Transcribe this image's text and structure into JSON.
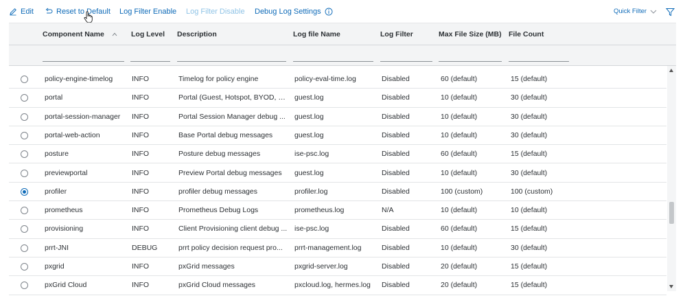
{
  "toolbar": {
    "edit_label": "Edit",
    "reset_label": "Reset to Default",
    "enable_label": "Log Filter Enable",
    "disable_label": "Log Filter Disable",
    "debug_label": "Debug Log Settings",
    "quick_filter_label": "Quick Filter"
  },
  "colors": {
    "link": "#0d6ab8",
    "link_disabled": "#8fc3e6",
    "header_bg": "#f3f4f5"
  },
  "columns": [
    "Component Name",
    "Log Level",
    "Description",
    "Log file Name",
    "Log Filter",
    "Max File Size (MB)",
    "File Count"
  ],
  "rows": [
    {
      "selected": false,
      "name": "policy-engine-timelog",
      "level": "INFO",
      "description": "Timelog for policy engine",
      "file": "policy-eval-time.log",
      "filter": "Disabled",
      "max_size": "60 (default)",
      "count": "15 (default)"
    },
    {
      "selected": false,
      "name": "portal",
      "level": "INFO",
      "description": "Portal (Guest, Hotspot, BYOD, C...",
      "file": "guest.log",
      "filter": "Disabled",
      "max_size": "10 (default)",
      "count": "30 (default)"
    },
    {
      "selected": false,
      "name": "portal-session-manager",
      "level": "INFO",
      "description": "Portal Session Manager debug ...",
      "file": "guest.log",
      "filter": "Disabled",
      "max_size": "10 (default)",
      "count": "30 (default)"
    },
    {
      "selected": false,
      "name": "portal-web-action",
      "level": "INFO",
      "description": "Base Portal debug messages",
      "file": "guest.log",
      "filter": "Disabled",
      "max_size": "10 (default)",
      "count": "30 (default)"
    },
    {
      "selected": false,
      "name": "posture",
      "level": "INFO",
      "description": "Posture debug messages",
      "file": "ise-psc.log",
      "filter": "Disabled",
      "max_size": "60 (default)",
      "count": "15 (default)"
    },
    {
      "selected": false,
      "name": "previewportal",
      "level": "INFO",
      "description": "Preview Portal debug messages",
      "file": "guest.log",
      "filter": "Disabled",
      "max_size": "10 (default)",
      "count": "30 (default)"
    },
    {
      "selected": true,
      "name": "profiler",
      "level": "INFO",
      "description": "profiler debug messages",
      "file": "profiler.log",
      "filter": "Disabled",
      "max_size": "100 (custom)",
      "count": "100 (custom)"
    },
    {
      "selected": false,
      "name": "prometheus",
      "level": "INFO",
      "description": "Prometheus Debug Logs",
      "file": "prometheus.log",
      "filter": "N/A",
      "max_size": "10 (default)",
      "count": "10 (default)"
    },
    {
      "selected": false,
      "name": "provisioning",
      "level": "INFO",
      "description": "Client Provisioning client debug ...",
      "file": "ise-psc.log",
      "filter": "Disabled",
      "max_size": "60 (default)",
      "count": "15 (default)"
    },
    {
      "selected": false,
      "name": "prrt-JNI",
      "level": "DEBUG",
      "description": "prrt policy decision request pro...",
      "file": "prrt-management.log",
      "filter": "Disabled",
      "max_size": "10 (default)",
      "count": "30 (default)"
    },
    {
      "selected": false,
      "name": "pxgrid",
      "level": "INFO",
      "description": "pxGrid messages",
      "file": "pxgrid-server.log",
      "filter": "Disabled",
      "max_size": "20 (default)",
      "count": "15 (default)"
    },
    {
      "selected": false,
      "name": "pxGrid Cloud",
      "level": "INFO",
      "description": "pxGrid Cloud messages",
      "file": "pxcloud.log, hermes.log",
      "filter": "Disabled",
      "max_size": "20 (default)",
      "count": "15 (default)"
    }
  ]
}
